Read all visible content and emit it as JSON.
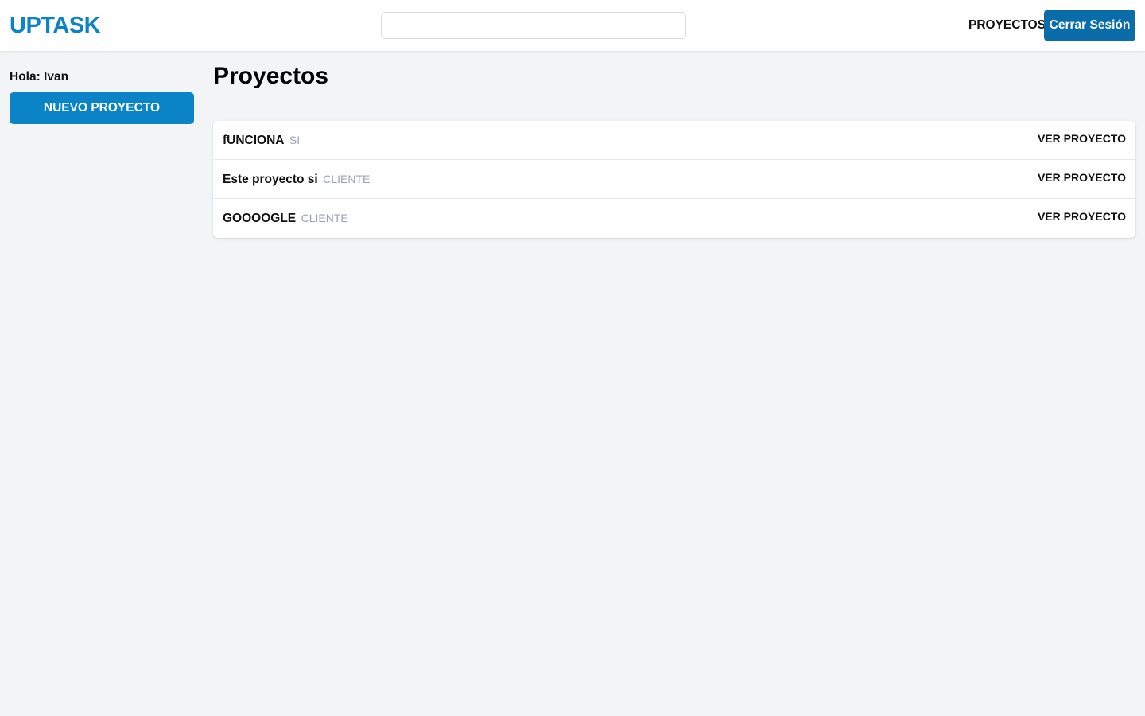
{
  "header": {
    "logo": "UPTASK",
    "search": {
      "value": "",
      "placeholder": ""
    },
    "nav_projects": "PROYECTOS",
    "logout_label": "Cerrar Sesión"
  },
  "sidebar": {
    "greeting": "Hola: Ivan",
    "new_project_label": "NUEVO PROYECTO"
  },
  "main": {
    "title": "Proyectos",
    "projects": [
      {
        "name": "fUNCIONA",
        "client": "SI",
        "action": "VER PROYECTO"
      },
      {
        "name": "Este proyecto si",
        "client": "CLIENTE",
        "action": "VER PROYECTO"
      },
      {
        "name": "GOOOOGLE",
        "client": "CLIENTE",
        "action": "VER PROYECTO"
      }
    ]
  },
  "colors": {
    "brand": "#0a84c6",
    "logout_button": "#0a6ca8",
    "background": "#f2f4f6",
    "client_text": "#9ca3af"
  }
}
